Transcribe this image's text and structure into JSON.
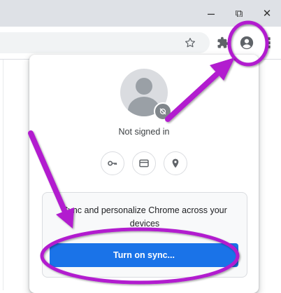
{
  "window_controls": {
    "minimize_glyph": "–",
    "restore_glyph": "⧉",
    "close_glyph": "✕"
  },
  "toolbar": {
    "menu_glyph": "⋮",
    "icons": [
      "bookmark-star-icon",
      "extensions-puzzle-icon",
      "profile-icon",
      "menu-icon"
    ]
  },
  "profile_popup": {
    "status": "Not signed in",
    "quick_actions": [
      "password-key-icon",
      "payment-card-icon",
      "address-location-icon"
    ],
    "sync_promo": "Sync and personalize Chrome across your devices",
    "sync_button": "Turn on sync..."
  },
  "annotations": {
    "color": "#b21fcf",
    "highlights": [
      "profile-button",
      "turn-on-sync-button"
    ]
  },
  "colors": {
    "titlebar": "#dee1e6",
    "accent_blue": "#1a73e8",
    "avatar_gray": "#9aa0a6"
  }
}
